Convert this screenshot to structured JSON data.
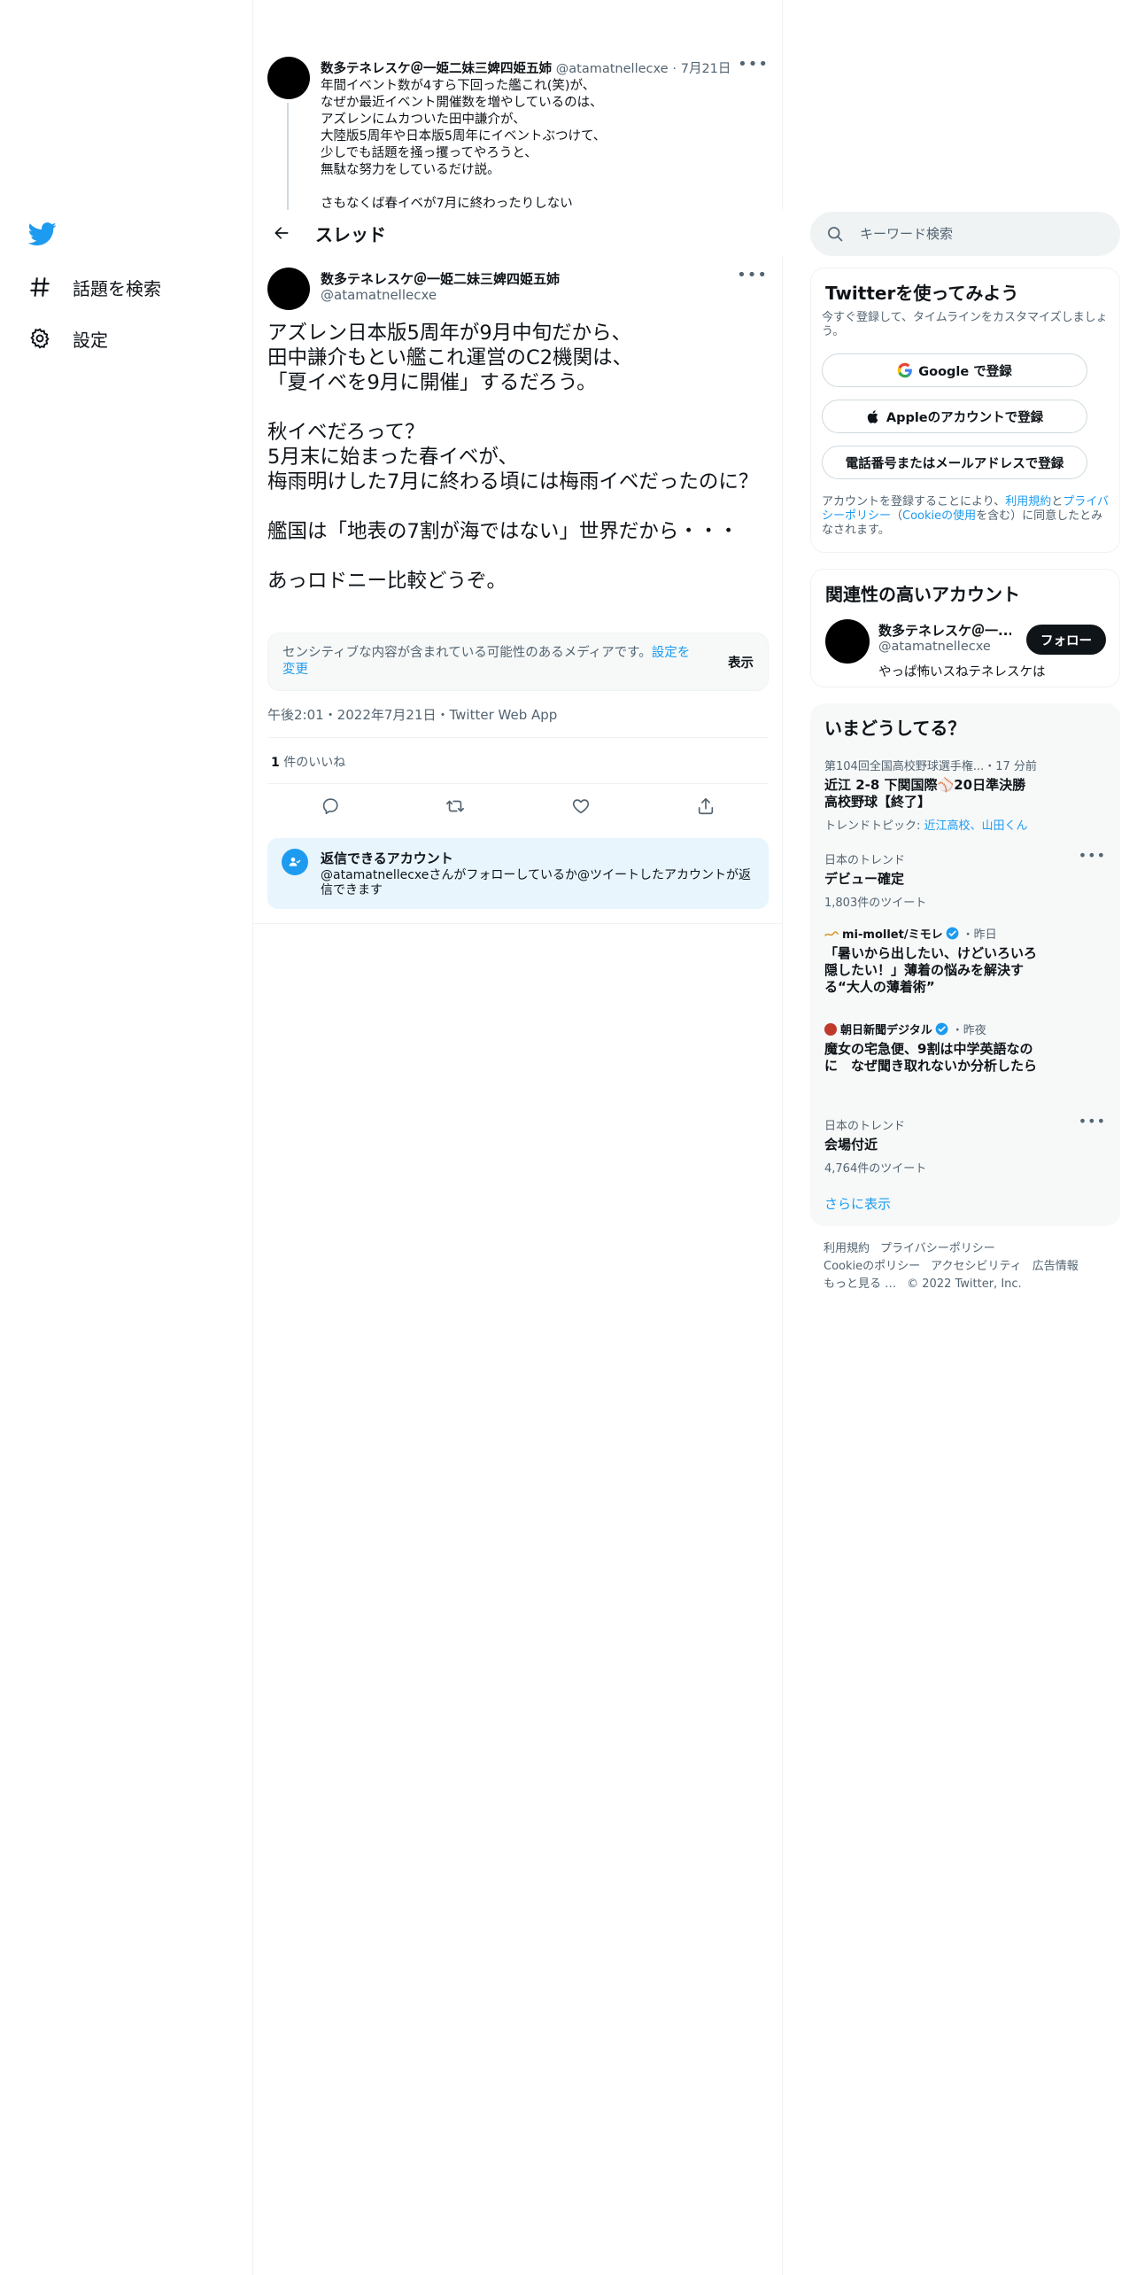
{
  "nav": {
    "explore_label": "話題を検索",
    "settings_label": "設定"
  },
  "prev_tweet": {
    "name": "数多テネレスケ＠一姫二妹三婢四姫五姉",
    "handle": "@atamatnellecxe",
    "date": "7月21日",
    "text": "年間イベント数が4すら下回った艦これ(笑)が、\nなぜか最近イベント開催数を増やしているのは、\nアズレンにムカついた田中謙介が、\n大陸版5周年や日本版5周年にイベントぶつけて、\n少しでも話題を掻っ攫ってやろうと、\n無駄な努力をしているだけ説。\n\nさもなくば春イベが7月に終わったりしない"
  },
  "thread": {
    "title": "スレッド",
    "name": "数多テネレスケ＠一姫二妹三婢四姫五姉",
    "handle": "@atamatnellecxe",
    "text": "アズレン日本版5周年が9月中旬だから、\n田中謙介もとい艦これ運営のC2機関は、\n「夏イベを9月に開催」するだろう。\n\n秋イベだろって？\n5月末に始まった春イベが、\n梅雨明けした7月に終わる頃には梅雨イベだったのに？\n\n艦国は「地表の7割が海ではない」世界だから・・・\n\nあっロドニー比較どうぞ。",
    "sensitive_msg": "センシティブな内容が含まれている可能性のあるメディアです。",
    "sensitive_link": "設定を変更",
    "sensitive_show": "表示",
    "meta": "午後2:01・2022年7月21日・Twitter Web App",
    "likes_count": "1",
    "likes_label": " 件のいいね",
    "reply_title": "返信できるアカウント",
    "reply_desc": "@atamatnellecxeさんがフォローしているか@ツイートしたアカウントが返信できます"
  },
  "search": {
    "placeholder": "キーワード検索"
  },
  "signup": {
    "title": "Twitterを使ってみよう",
    "subtitle": "今すぐ登録して、タイムラインをカスタマイズしましょう。",
    "google": "Google で登録",
    "apple": "Appleのアカウントで登録",
    "phone": "電話番号またはメールアドレスで登録",
    "terms_pre": "アカウントを登録することにより、",
    "terms_link1": "利用規約",
    "terms_and": "と",
    "terms_link2": "プライバシーポリシー",
    "terms_paren_open": "（",
    "terms_link3": "Cookieの使用",
    "terms_post": "を含む）に同意したとみなされます。"
  },
  "related": {
    "title": "関連性の高いアカウント",
    "name": "数多テネレスケ＠一...",
    "handle": "@atamatnellecxe",
    "bio": "やっぱ怖いスねテネレスケは",
    "follow": "フォロー"
  },
  "trends": {
    "title": "いまどうしてる？",
    "items": [
      {
        "context": "第104回全国高校野球選手権...",
        "time": "・17 分前",
        "title": "近江 2-8 下関国際⚾20日準決勝\n高校野球【終了】",
        "topic_label": "トレンドトピック: ",
        "topic_links": "近江高校、山田くん"
      },
      {
        "context": "日本のトレンド",
        "title": "デビュー確定",
        "count": "1,803件のツイート"
      },
      {
        "source": "mi-mollet/ミモレ",
        "time": "・昨日",
        "title": "「暑いから出したい、けどいろいろ隠したい！」薄着の悩みを解決する“大人の薄着術”"
      },
      {
        "source": "朝日新聞デジタル",
        "time": "・昨夜",
        "title": "魔女の宅急便、9割は中学英語なのに　なぜ聞き取れないか分析したら"
      },
      {
        "context": "日本のトレンド",
        "title": "会場付近",
        "count": "4,764件のツイート"
      }
    ],
    "show_more": "さらに表示"
  },
  "footer": {
    "links": [
      "利用規約",
      "プライバシーポリシー",
      "Cookieのポリシー",
      "アクセシビリティ",
      "広告情報",
      "もっと見る …"
    ],
    "copyright": "© 2022 Twitter, Inc."
  },
  "colors": {
    "accent": "#1d9bf0",
    "text": "#0f1419",
    "muted": "#536471"
  }
}
